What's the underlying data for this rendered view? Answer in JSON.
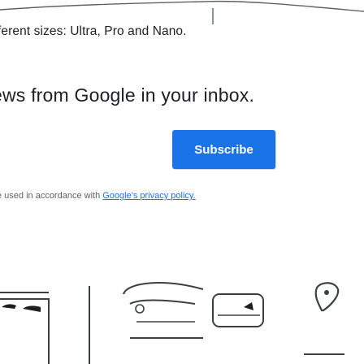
{
  "tagline": "ferent sizes: Ultra, Pro and Nano.",
  "headline": "ews from Google in your inbox.",
  "subscribe_label": "Subscribe",
  "disclaimer": {
    "prefix": "e used in accordance with ",
    "link_text": "Google's privacy policy."
  },
  "colors": {
    "button": "#1a73e8",
    "link": "#1a73e8",
    "text": "#202124",
    "muted": "#5f6368"
  },
  "icons": [
    "decorative-wave-art",
    "gadgets-illustration"
  ]
}
